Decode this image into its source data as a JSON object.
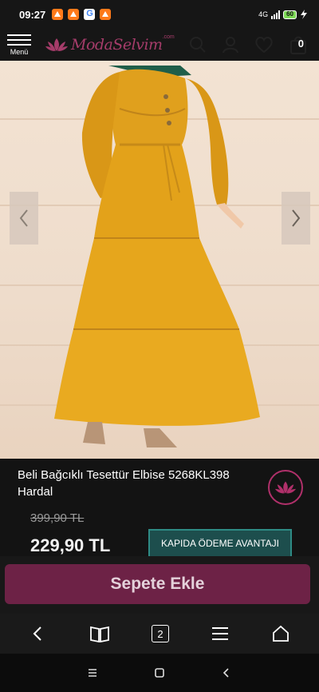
{
  "status_bar": {
    "time": "09:27",
    "network": "4G",
    "battery": "60"
  },
  "header": {
    "menu_label": "Menü",
    "logo_text": "ModaSelvim",
    "logo_suffix": ".com",
    "cart_count": "0"
  },
  "product": {
    "title": "Beli Bağcıklı Tesettür Elbise 5268KL398 Hardal",
    "old_price": "399,90 TL",
    "price": "229,90 TL",
    "cod_label": "KAPIDA ÖDEME AVANTAJI",
    "add_to_cart_label": "Sepete Ekle"
  },
  "browser_nav": {
    "tab_count": "2"
  },
  "icons": {
    "header": [
      "menu-icon",
      "search-icon",
      "user-icon",
      "heart-icon",
      "cart-icon"
    ],
    "carousel": [
      "chevron-left-icon",
      "chevron-right-icon"
    ],
    "browser": [
      "back-icon",
      "bookmarks-icon",
      "tabs-icon",
      "menu-icon",
      "home-icon"
    ],
    "system": [
      "recents-icon",
      "home-icon",
      "back-icon"
    ]
  },
  "colors": {
    "brand": "#a63c6a",
    "cta": "#6d2246",
    "cod": "#1d4e4d",
    "dress": "#e3a21a"
  }
}
